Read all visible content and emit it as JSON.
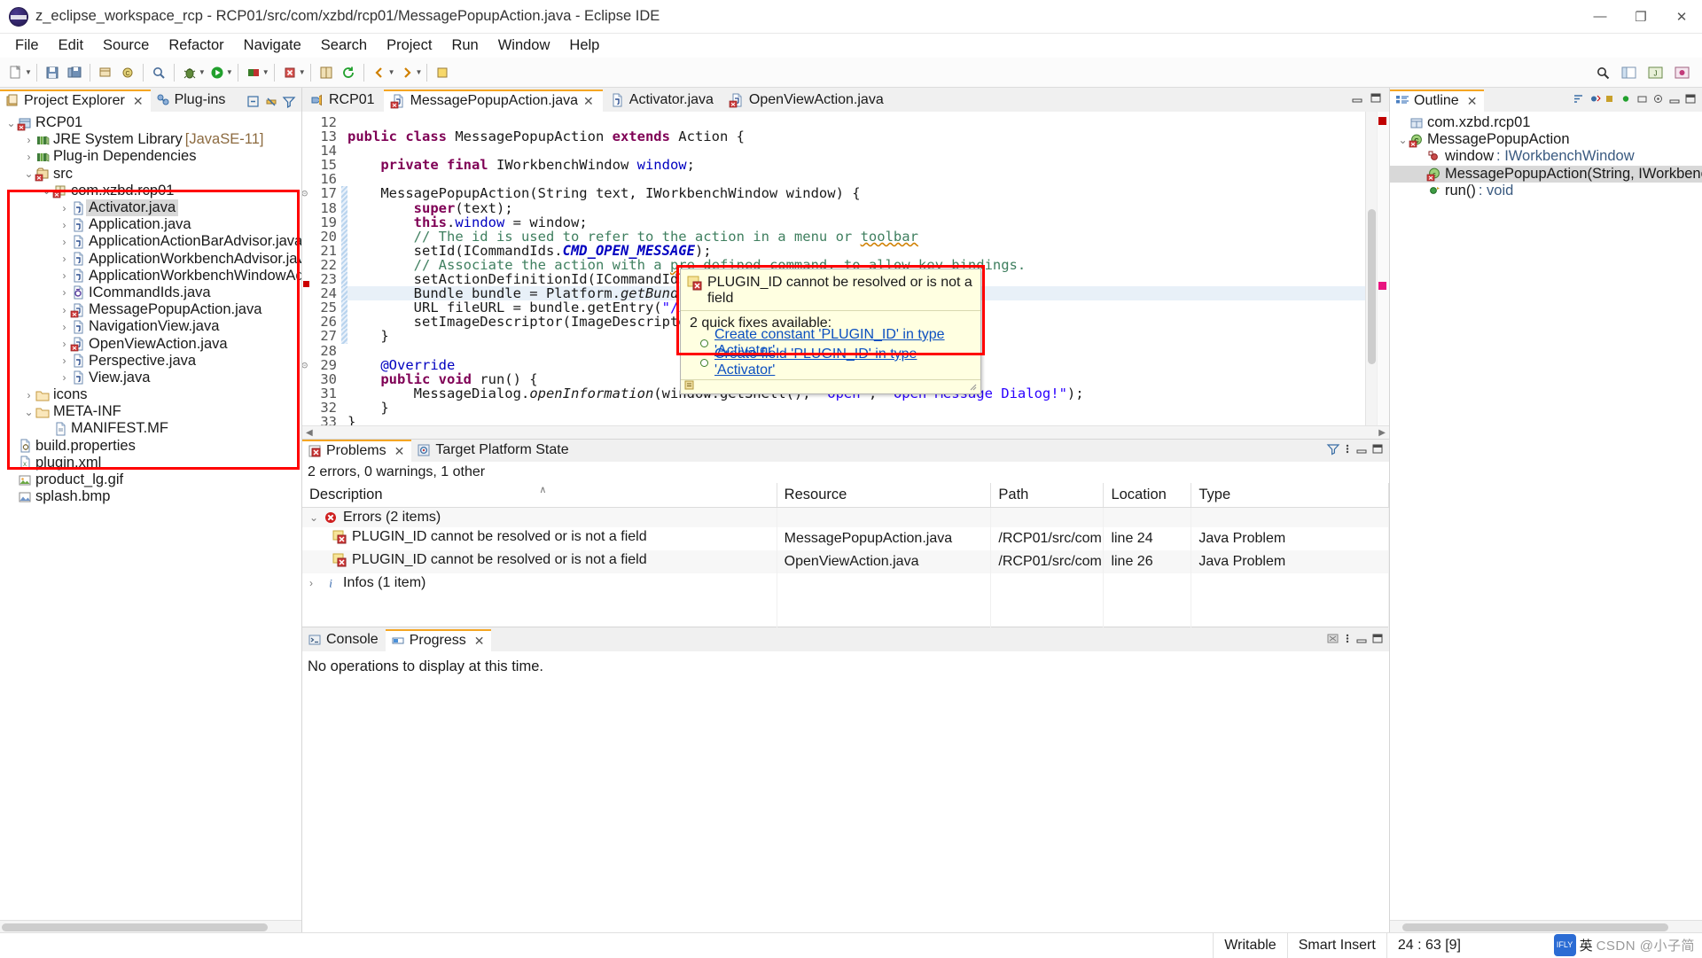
{
  "window": {
    "title": "z_eclipse_workspace_rcp - RCP01/src/com/xzbd/rcp01/MessagePopupAction.java - Eclipse IDE",
    "minimize": "—",
    "maximize": "❐",
    "close": "✕"
  },
  "menubar": {
    "items": [
      "File",
      "Edit",
      "Source",
      "Refactor",
      "Navigate",
      "Search",
      "Project",
      "Run",
      "Window",
      "Help"
    ]
  },
  "left": {
    "tabs": [
      {
        "label": "Project Explorer",
        "icon": "project-explorer-icon",
        "active": true,
        "closable": true
      },
      {
        "label": "Plug-ins",
        "icon": "plugins-icon",
        "active": false,
        "closable": false
      }
    ],
    "tools": [
      "collapse-all-icon",
      "link-with-editor-icon",
      "view-menu-filter-icon"
    ],
    "tree": [
      {
        "indent": 0,
        "arrow": "v",
        "icon": "project-icon",
        "label": "RCP01",
        "suffix": ""
      },
      {
        "indent": 1,
        "arrow": ">",
        "icon": "library-icon",
        "label": "JRE System Library",
        "suffix": "[JavaSE-11]"
      },
      {
        "indent": 1,
        "arrow": ">",
        "icon": "library-icon",
        "label": "Plug-in Dependencies",
        "suffix": ""
      },
      {
        "indent": 1,
        "arrow": "v",
        "icon": "source-folder-icon",
        "label": "src",
        "suffix": ""
      },
      {
        "indent": 2,
        "arrow": "v",
        "icon": "package-icon",
        "label": "com.xzbd.rcp01",
        "suffix": ""
      },
      {
        "indent": 3,
        "arrow": ">",
        "icon": "java-file-icon",
        "label": "Activator.java",
        "suffix": "",
        "selected": true
      },
      {
        "indent": 3,
        "arrow": ">",
        "icon": "java-file-icon",
        "label": "Application.java",
        "suffix": ""
      },
      {
        "indent": 3,
        "arrow": ">",
        "icon": "java-file-icon",
        "label": "ApplicationActionBarAdvisor.java",
        "suffix": ""
      },
      {
        "indent": 3,
        "arrow": ">",
        "icon": "java-file-icon",
        "label": "ApplicationWorkbenchAdvisor.java",
        "suffix": ""
      },
      {
        "indent": 3,
        "arrow": ">",
        "icon": "java-file-icon",
        "label": "ApplicationWorkbenchWindowAdvisor.java",
        "suffix": ""
      },
      {
        "indent": 3,
        "arrow": ">",
        "icon": "java-interface-icon",
        "label": "ICommandIds.java",
        "suffix": ""
      },
      {
        "indent": 3,
        "arrow": ">",
        "icon": "java-file-error-icon",
        "label": "MessagePopupAction.java",
        "suffix": ""
      },
      {
        "indent": 3,
        "arrow": ">",
        "icon": "java-file-icon",
        "label": "NavigationView.java",
        "suffix": ""
      },
      {
        "indent": 3,
        "arrow": ">",
        "icon": "java-file-error-icon",
        "label": "OpenViewAction.java",
        "suffix": ""
      },
      {
        "indent": 3,
        "arrow": ">",
        "icon": "java-file-icon",
        "label": "Perspective.java",
        "suffix": ""
      },
      {
        "indent": 3,
        "arrow": ">",
        "icon": "java-file-icon",
        "label": "View.java",
        "suffix": ""
      },
      {
        "indent": 1,
        "arrow": ">",
        "icon": "folder-icon",
        "label": "icons",
        "suffix": ""
      },
      {
        "indent": 1,
        "arrow": "v",
        "icon": "folder-icon",
        "label": "META-INF",
        "suffix": ""
      },
      {
        "indent": 2,
        "arrow": "",
        "icon": "manifest-icon",
        "label": "MANIFEST.MF",
        "suffix": ""
      },
      {
        "indent": 0,
        "arrow": "",
        "icon": "properties-icon",
        "label": "build.properties",
        "suffix": ""
      },
      {
        "indent": 0,
        "arrow": "",
        "icon": "xml-icon",
        "label": "plugin.xml",
        "suffix": ""
      },
      {
        "indent": 0,
        "arrow": "",
        "icon": "gif-icon",
        "label": "product_lg.gif",
        "suffix": ""
      },
      {
        "indent": 0,
        "arrow": "",
        "icon": "bmp-icon",
        "label": "splash.bmp",
        "suffix": ""
      }
    ]
  },
  "editor": {
    "tabs": [
      {
        "label": "RCP01",
        "icon": "product-icon",
        "active": false,
        "closable": false
      },
      {
        "label": "MessagePopupAction.java",
        "icon": "java-file-error-icon",
        "active": true,
        "closable": true
      },
      {
        "label": "Activator.java",
        "icon": "java-file-icon",
        "active": false,
        "closable": false
      },
      {
        "label": "OpenViewAction.java",
        "icon": "java-file-error-icon",
        "active": false,
        "closable": false
      }
    ],
    "first_line": 12,
    "lines": [
      {
        "n": 12,
        "fold": "",
        "mod": false,
        "error": false,
        "html": ""
      },
      {
        "n": 13,
        "fold": "",
        "mod": false,
        "error": false,
        "html": "<span class='kw'>public class</span> MessagePopupAction <span class='kw'>extends</span> Action {"
      },
      {
        "n": 14,
        "fold": "",
        "mod": false,
        "error": false,
        "html": ""
      },
      {
        "n": 15,
        "fold": "",
        "mod": false,
        "error": false,
        "html": "    <span class='kw'>private final</span> IWorkbenchWindow <span class='fld'>window</span>;"
      },
      {
        "n": 16,
        "fold": "",
        "mod": false,
        "error": false,
        "html": ""
      },
      {
        "n": 17,
        "fold": "⊝",
        "mod": true,
        "error": false,
        "html": "    MessagePopupAction(String text, IWorkbenchWindow window) {"
      },
      {
        "n": 18,
        "fold": "",
        "mod": true,
        "error": false,
        "html": "        <span class='kw'>super</span>(text);"
      },
      {
        "n": 19,
        "fold": "",
        "mod": true,
        "error": false,
        "html": "        <span class='kw'>this</span>.<span class='fld'>window</span> = window;"
      },
      {
        "n": 20,
        "fold": "",
        "mod": true,
        "error": false,
        "html": "        <span class='cm'>// The id is used to refer to the action in a menu or <span class='squig'>toolbar</span></span>"
      },
      {
        "n": 21,
        "fold": "",
        "mod": true,
        "error": false,
        "html": "        setId(ICommandIds.<span class='stfld'>CMD_OPEN_MESSAGE</span>);"
      },
      {
        "n": 22,
        "fold": "",
        "mod": true,
        "error": false,
        "html": "        <span class='cm'>// Associate the action with a <span class='squig'>pre</span>-defined command, to allow key bindings.</span>"
      },
      {
        "n": 23,
        "fold": "",
        "mod": true,
        "error": false,
        "html": "        setActionDefinitionId(ICommandIds.<span class='stfld'>CMD_OPEN_MESSAGE</span>);"
      },
      {
        "n": 24,
        "fold": "",
        "mod": true,
        "error": true,
        "hl": true,
        "html": "        Bundle bundle = Platform.<span class='mth'>getBundle</span>(Activator.<span class='sel-tok'>PLUGIN_ID</span>);"
      },
      {
        "n": 25,
        "fold": "",
        "mod": true,
        "error": false,
        "html": "        URL fileURL = bundle.getEntry(<span class='st'>\"/icons/sample3.gif\"</span>);"
      },
      {
        "n": 26,
        "fold": "",
        "mod": true,
        "error": false,
        "html": "        setImageDescriptor(ImageDescriptor.<span class='mth'>createFromURL</span>(fileURL));"
      },
      {
        "n": 27,
        "fold": "",
        "mod": true,
        "error": false,
        "html": "    }"
      },
      {
        "n": 28,
        "fold": "",
        "mod": false,
        "error": false,
        "html": ""
      },
      {
        "n": 29,
        "fold": "⊝",
        "mod": false,
        "error": false,
        "html": "    <span class='fld'>@Override</span>"
      },
      {
        "n": 30,
        "fold": "",
        "mod": false,
        "error": false,
        "html": "    <span class='kw'>public void</span> run() {"
      },
      {
        "n": 31,
        "fold": "",
        "mod": false,
        "error": false,
        "html": "        MessageDialog.<span class='mth'>openInformation</span>(window.getShell(), <span class='st'>\"Open\"</span>, <span class='st'>\"Open Message Dialog!\"</span>);"
      },
      {
        "n": 32,
        "fold": "",
        "mod": false,
        "error": false,
        "html": "    }"
      },
      {
        "n": 33,
        "fold": "",
        "mod": false,
        "error": false,
        "html": "}"
      }
    ]
  },
  "quickfix": {
    "message": "PLUGIN_ID cannot be resolved or is not a field",
    "subtitle": "2 quick fixes available:",
    "items": [
      "Create constant 'PLUGIN_ID' in type 'Activator'",
      "Create field 'PLUGIN_ID' in type 'Activator'"
    ],
    "error_icon": "error-marker-icon"
  },
  "problems": {
    "tabs": [
      {
        "label": "Problems",
        "icon": "problems-icon",
        "active": true,
        "closable": true
      },
      {
        "label": "Target Platform State",
        "icon": "target-platform-icon",
        "active": false,
        "closable": false
      }
    ],
    "summary": "2 errors, 0 warnings, 1 other",
    "columns": [
      "Description",
      "Resource",
      "Path",
      "Location",
      "Type"
    ],
    "sorted_column": "Description",
    "rows": [
      {
        "kind": "group",
        "icon": "error-group-icon",
        "arrow": "v",
        "description": "Errors (2 items)",
        "resource": "",
        "path": "",
        "location": "",
        "type": ""
      },
      {
        "kind": "item",
        "icon": "error-marker-icon",
        "arrow": "",
        "description": "PLUGIN_ID cannot be resolved or is not a field",
        "resource": "MessagePopupAction.java",
        "path": "/RCP01/src/com...",
        "location": "line 24",
        "type": "Java Problem"
      },
      {
        "kind": "item",
        "icon": "error-marker-icon",
        "arrow": "",
        "description": "PLUGIN_ID cannot be resolved or is not a field",
        "resource": "OpenViewAction.java",
        "path": "/RCP01/src/com...",
        "location": "line 26",
        "type": "Java Problem"
      },
      {
        "kind": "group",
        "icon": "info-group-icon",
        "arrow": ">",
        "description": "Infos (1 item)",
        "resource": "",
        "path": "",
        "location": "",
        "type": ""
      }
    ]
  },
  "console": {
    "tabs": [
      {
        "label": "Console",
        "icon": "console-icon",
        "active": false,
        "closable": false
      },
      {
        "label": "Progress",
        "icon": "progress-icon",
        "active": true,
        "closable": true
      }
    ],
    "body": "No operations to display at this time."
  },
  "outline": {
    "tabs": [
      {
        "label": "Outline",
        "icon": "outline-icon",
        "active": true,
        "closable": true
      }
    ],
    "tools": [
      "sort-icon",
      "hide-fields-icon",
      "hide-static-icon",
      "hide-nonpublic-icon",
      "hide-local-icon",
      "focus-icon",
      "minimize-icon",
      "maximize-icon"
    ],
    "tree": [
      {
        "indent": 0,
        "arrow": "",
        "icon": "package-decl-icon",
        "label": "com.xzbd.rcp01",
        "selected": false,
        "kind": "plain"
      },
      {
        "indent": 0,
        "arrow": "v",
        "icon": "class-error-icon",
        "label": "MessagePopupAction",
        "selected": false,
        "kind": "plain"
      },
      {
        "indent": 1,
        "arrow": "",
        "icon": "field-private-icon",
        "label": "window",
        "suffix": ": IWorkbenchWindow",
        "selected": false,
        "kind": "member"
      },
      {
        "indent": 1,
        "arrow": "",
        "icon": "ctor-error-icon",
        "label": "MessagePopupAction(String, IWorkbenchWindow)",
        "selected": true,
        "kind": "member"
      },
      {
        "indent": 1,
        "arrow": "",
        "icon": "method-public-icon",
        "label": "run()",
        "suffix": ": void",
        "selected": false,
        "kind": "member"
      }
    ]
  },
  "statusbar": {
    "writable": "Writable",
    "insert_mode": "Smart Insert",
    "position": "24 : 63 [9]"
  },
  "watermark": {
    "ime_lang": "英",
    "ime_dot": "·",
    "csdn": "CSDN @小子简",
    "logo": "IFLY"
  },
  "colors": {
    "accent": "#f5a623",
    "error": "#c00000",
    "link": "#0b4fc0",
    "annotation": "#ff0000",
    "selection": "#3399ff",
    "popup_bg": "#ffffe1"
  }
}
